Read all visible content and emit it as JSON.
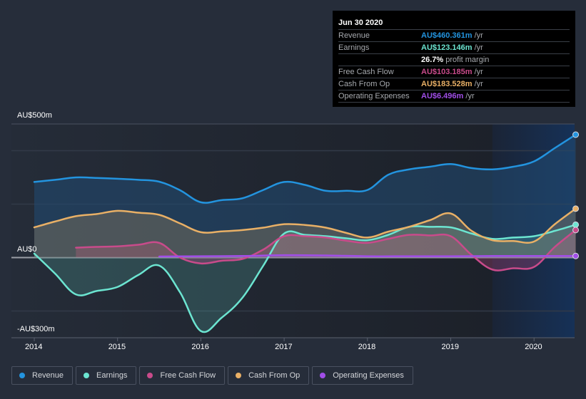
{
  "tooltip": {
    "date": "Jun 30 2020",
    "rows": [
      {
        "label": "Revenue",
        "value": "AU$460.361m",
        "unit": " /yr",
        "color": "#2394df"
      },
      {
        "label": "Earnings",
        "value": "AU$123.146m",
        "unit": " /yr",
        "color": "#6ce5d1"
      },
      {
        "label": "",
        "value": "26.7%",
        "unit": " profit margin",
        "color": "#ffffff"
      },
      {
        "label": "Free Cash Flow",
        "value": "AU$103.185m",
        "unit": " /yr",
        "color": "#c94b8b"
      },
      {
        "label": "Cash From Op",
        "value": "AU$183.528m",
        "unit": " /yr",
        "color": "#e9b066"
      },
      {
        "label": "Operating Expenses",
        "value": "AU$6.496m",
        "unit": " /yr",
        "color": "#a14ee8"
      }
    ]
  },
  "legend": [
    {
      "label": "Revenue",
      "color": "#2394df"
    },
    {
      "label": "Earnings",
      "color": "#6ce5d1"
    },
    {
      "label": "Free Cash Flow",
      "color": "#c94b8b"
    },
    {
      "label": "Cash From Op",
      "color": "#e9b066"
    },
    {
      "label": "Operating Expenses",
      "color": "#a14ee8"
    }
  ],
  "chart_data": {
    "type": "area",
    "title": "",
    "xlabel": "",
    "ylabel": "",
    "y_top_label": "AU$500m",
    "y_zero_label": "AU$0",
    "y_bottom_label": "-AU$300m",
    "ylim": [
      -300,
      500
    ],
    "xlim": [
      2013.97,
      2020.5
    ],
    "x_ticks": [
      2014,
      2015,
      2016,
      2017,
      2018,
      2019,
      2020
    ],
    "x_tick_labels": [
      "2014",
      "2015",
      "2016",
      "2017",
      "2018",
      "2019",
      "2020"
    ],
    "gridlines": [
      400,
      200,
      0,
      -200
    ],
    "forecast_start": 2019.5,
    "grid": true,
    "legend_position": "bottom",
    "series": [
      {
        "name": "Revenue",
        "color": "#2394df",
        "x": [
          2014.0,
          2014.25,
          2014.5,
          2014.75,
          2015.0,
          2015.25,
          2015.5,
          2015.75,
          2016.0,
          2016.25,
          2016.5,
          2016.75,
          2017.0,
          2017.25,
          2017.5,
          2017.75,
          2018.0,
          2018.25,
          2018.5,
          2018.75,
          2019.0,
          2019.25,
          2019.5,
          2019.75,
          2020.0,
          2020.25,
          2020.5
        ],
        "values": [
          283,
          291,
          300,
          298,
          295,
          291,
          284,
          252,
          207,
          215,
          222,
          253,
          283,
          272,
          250,
          250,
          253,
          310,
          330,
          340,
          350,
          335,
          330,
          340,
          360,
          410,
          460
        ]
      },
      {
        "name": "Earnings",
        "color": "#6ce5d1",
        "x": [
          2014.0,
          2014.25,
          2014.5,
          2014.75,
          2015.0,
          2015.25,
          2015.5,
          2015.75,
          2016.0,
          2016.25,
          2016.5,
          2016.75,
          2017.0,
          2017.25,
          2017.5,
          2017.75,
          2018.0,
          2018.25,
          2018.5,
          2018.75,
          2019.0,
          2019.25,
          2019.5,
          2019.75,
          2020.0,
          2020.25,
          2020.5
        ],
        "values": [
          15,
          -60,
          -138,
          -125,
          -110,
          -65,
          -30,
          -130,
          -275,
          -225,
          -150,
          -30,
          90,
          85,
          80,
          72,
          65,
          85,
          115,
          115,
          113,
          90,
          70,
          75,
          80,
          100,
          123
        ]
      },
      {
        "name": "Free Cash Flow",
        "color": "#c94b8b",
        "x": [
          2014.5,
          2014.75,
          2015.0,
          2015.25,
          2015.5,
          2015.75,
          2016.0,
          2016.25,
          2016.5,
          2016.75,
          2017.0,
          2017.25,
          2017.5,
          2017.75,
          2018.0,
          2018.25,
          2018.5,
          2018.75,
          2019.0,
          2019.25,
          2019.5,
          2019.75,
          2020.0,
          2020.25,
          2020.5
        ],
        "values": [
          37,
          40,
          42,
          48,
          55,
          0,
          -22,
          -12,
          -5,
          30,
          80,
          80,
          75,
          63,
          55,
          70,
          85,
          83,
          80,
          10,
          -45,
          -40,
          -35,
          40,
          103
        ]
      },
      {
        "name": "Cash From Op",
        "color": "#e9b066",
        "x": [
          2014.0,
          2014.25,
          2014.5,
          2014.75,
          2015.0,
          2015.25,
          2015.5,
          2015.75,
          2016.0,
          2016.25,
          2016.5,
          2016.75,
          2017.0,
          2017.25,
          2017.5,
          2017.75,
          2018.0,
          2018.25,
          2018.5,
          2018.75,
          2019.0,
          2019.25,
          2019.5,
          2019.75,
          2020.0,
          2020.25,
          2020.5
        ],
        "values": [
          113,
          135,
          155,
          163,
          175,
          168,
          160,
          128,
          95,
          98,
          103,
          112,
          125,
          122,
          112,
          92,
          75,
          97,
          115,
          140,
          165,
          100,
          65,
          62,
          60,
          125,
          183
        ]
      },
      {
        "name": "Operating Expenses",
        "color": "#a14ee8",
        "x": [
          2015.5,
          2016.0,
          2016.5,
          2017.0,
          2017.5,
          2018.0,
          2018.5,
          2019.0,
          2019.5,
          2020.0,
          2020.5
        ],
        "values": [
          4,
          5,
          6,
          9,
          8,
          5,
          5,
          5,
          6,
          6,
          6
        ]
      }
    ]
  }
}
